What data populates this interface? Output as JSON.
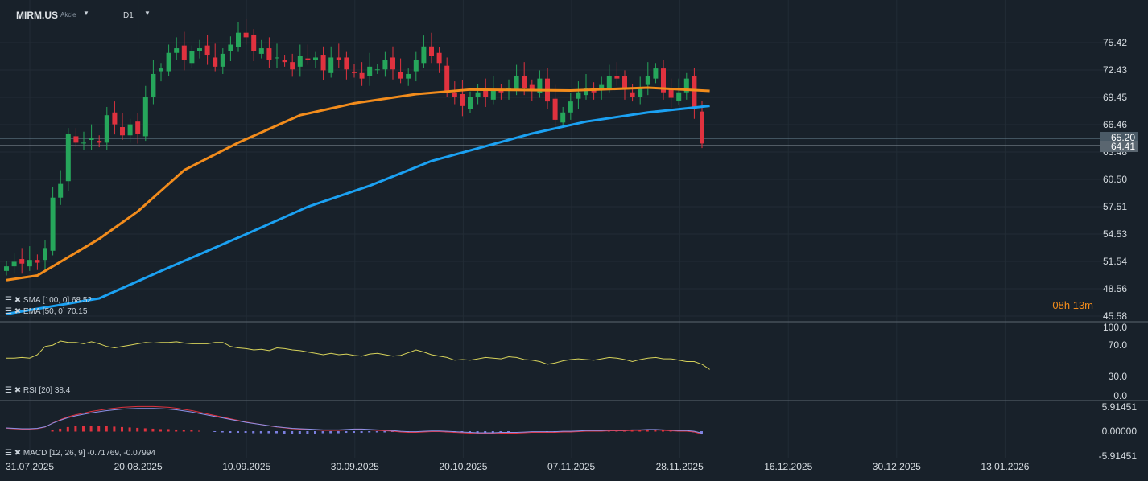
{
  "header": {
    "symbol": "MIRM.US",
    "type": "Akcie",
    "timeframe": "D1"
  },
  "price_axis": [
    "75.42",
    "72.43",
    "69.45",
    "66.46",
    "63.48",
    "60.50",
    "57.51",
    "54.53",
    "51.54",
    "48.56",
    "45.58"
  ],
  "price_tags": {
    "sma": "65.20",
    "last": "64.41"
  },
  "timer": "08h 13m",
  "indicators": {
    "sma": "SMA [100, 0] 68.52",
    "ema": "EMA [50, 0] 70.15",
    "rsi": "RSI [20] 38.4",
    "macd": "MACD [12, 26, 9] -0.71769, -0.07994"
  },
  "rsi_axis": [
    "100.0",
    "70.0",
    "30.0",
    "0.0"
  ],
  "macd_axis": [
    "5.91451",
    "0.00000",
    "-5.91451"
  ],
  "dates": [
    "31.07.2025",
    "20.08.2025",
    "10.09.2025",
    "30.09.2025",
    "20.10.2025",
    "07.11.2025",
    "28.11.2025",
    "16.12.2025",
    "30.12.2025",
    "13.01.2026"
  ],
  "colors": {
    "up": "#26a65b",
    "down": "#e0323f",
    "ema": "#f28c1c",
    "sma": "#1ba1f2",
    "rsi": "#d6d25a"
  },
  "closes": [
    51,
    51.5,
    51.3,
    51.7,
    51.4,
    53,
    58.5,
    60,
    65.5,
    64.5,
    64.5,
    65,
    64.5,
    67.5,
    66.5,
    65.3,
    66.5,
    65.5,
    69.5,
    72,
    72.6,
    74.3,
    74.8,
    73.5,
    74.5,
    74.8,
    74.1,
    72.8,
    74.2,
    75.2,
    76.5,
    76,
    74.5,
    74.8,
    73.5,
    73.8,
    73.3,
    72.5,
    74,
    73.5,
    73.8,
    72.4,
    73.8,
    73.5,
    72.5,
    72.1,
    71.5,
    72.8,
    72.5,
    73.5,
    72.5,
    71.5,
    72,
    73.5,
    75,
    74,
    73.2,
    70,
    69.5,
    68.5,
    69.5,
    70,
    69.5,
    70.3,
    70,
    70.5,
    71.8,
    70.5,
    70.2,
    71.5,
    69,
    67,
    67.8,
    69,
    70,
    70.5,
    70,
    70.8,
    71.8,
    71.5,
    70.3,
    69.5,
    70.5,
    71.8,
    72.6,
    70,
    69.4,
    70,
    71.5,
    68.2,
    64.41
  ],
  "ema": [
    [
      0,
      49.5
    ],
    [
      4,
      50
    ],
    [
      12,
      54
    ],
    [
      17,
      57
    ],
    [
      23,
      61.5
    ],
    [
      30,
      64.5
    ],
    [
      38,
      67.5
    ],
    [
      45,
      68.8
    ],
    [
      53,
      69.8
    ],
    [
      60,
      70.3
    ],
    [
      73,
      70.2
    ],
    [
      83,
      70.5
    ],
    [
      91,
      70.15
    ]
  ],
  "sma": [
    [
      0,
      45.8
    ],
    [
      12,
      47.5
    ],
    [
      20,
      50.5
    ],
    [
      31,
      54.5
    ],
    [
      39,
      57.5
    ],
    [
      47,
      59.8
    ],
    [
      55,
      62.5
    ],
    [
      68,
      65.5
    ],
    [
      75,
      66.8
    ],
    [
      83,
      67.8
    ],
    [
      91,
      68.52
    ]
  ],
  "rsi": [
    55,
    55,
    56,
    55,
    60,
    72,
    74,
    80,
    78,
    78,
    76,
    79,
    76,
    72,
    70,
    72,
    74,
    76,
    78,
    77,
    78,
    78,
    79,
    77,
    76,
    76,
    76,
    78,
    78,
    72,
    70,
    69,
    67,
    68,
    66,
    70,
    69,
    67,
    66,
    64,
    62,
    60,
    62,
    60,
    61,
    59,
    58,
    61,
    62,
    60,
    58,
    59,
    63,
    67,
    64,
    60,
    58,
    56,
    52,
    53,
    52,
    54,
    56,
    55,
    54,
    57,
    56,
    53,
    52,
    50,
    46,
    48,
    51,
    53,
    54,
    53,
    52,
    54,
    56,
    55,
    53,
    50,
    53,
    55,
    56,
    54,
    54,
    52,
    50,
    50,
    46,
    38.4
  ],
  "macd_hist": [
    0,
    0,
    0,
    0,
    0,
    0,
    0.3,
    0.6,
    1,
    1.2,
    1.3,
    1.3,
    1.3,
    1.2,
    1.1,
    1,
    0.9,
    0.8,
    0.7,
    0.6,
    0.5,
    0.5,
    0.4,
    0.3,
    0.2,
    0.1,
    0,
    -0.1,
    -0.2,
    -0.3,
    -0.3,
    -0.3,
    -0.4,
    -0.4,
    -0.4,
    -0.4,
    -0.5,
    -0.5,
    -0.5,
    -0.5,
    -0.5,
    -0.4,
    -0.4,
    -0.4,
    -0.3,
    -0.3,
    -0.3,
    -0.2,
    -0.2,
    -0.2,
    -0.1,
    -0.1,
    -0.1,
    0,
    0,
    0,
    -0.1,
    -0.2,
    -0.3,
    -0.3,
    -0.3,
    -0.3,
    -0.2,
    -0.2,
    -0.1,
    -0.1,
    0,
    0,
    0,
    0,
    -0.1,
    -0.2,
    -0.2,
    -0.2,
    -0.1,
    0,
    0.1,
    0.2,
    0.3,
    0.3,
    0.3,
    0.2,
    0.2,
    0.3,
    0.3,
    0.2,
    0.1,
    0.1,
    0,
    -0.2,
    -0.5
  ],
  "macd_line": [
    0.7,
    0.6,
    0.5,
    0.5,
    0.6,
    1,
    2,
    2.8,
    3.5,
    4,
    4.4,
    4.8,
    5.1,
    5.4,
    5.6,
    5.8,
    5.9,
    6,
    6,
    6,
    5.9,
    5.8,
    5.6,
    5.3,
    5,
    4.6,
    4.2,
    3.8,
    3.4,
    3,
    2.6,
    2.2,
    1.9,
    1.6,
    1.3,
    1,
    0.8,
    0.6,
    0.5,
    0.4,
    0.3,
    0.2,
    0.2,
    0.2,
    0.3,
    0.4,
    0.4,
    0.3,
    0.2,
    0.1,
    0,
    -0.2,
    -0.3,
    -0.3,
    -0.2,
    -0.1,
    -0.1,
    -0.2,
    -0.3,
    -0.4,
    -0.5,
    -0.6,
    -0.6,
    -0.6,
    -0.5,
    -0.5,
    -0.5,
    -0.4,
    -0.3,
    -0.3,
    -0.3,
    -0.3,
    -0.2,
    -0.2,
    -0.1,
    0,
    0,
    0,
    0.1,
    0.1,
    0.1,
    0.2,
    0.2,
    0.3,
    0.3,
    0.2,
    0.1,
    0,
    0,
    -0.2,
    -0.72
  ]
}
